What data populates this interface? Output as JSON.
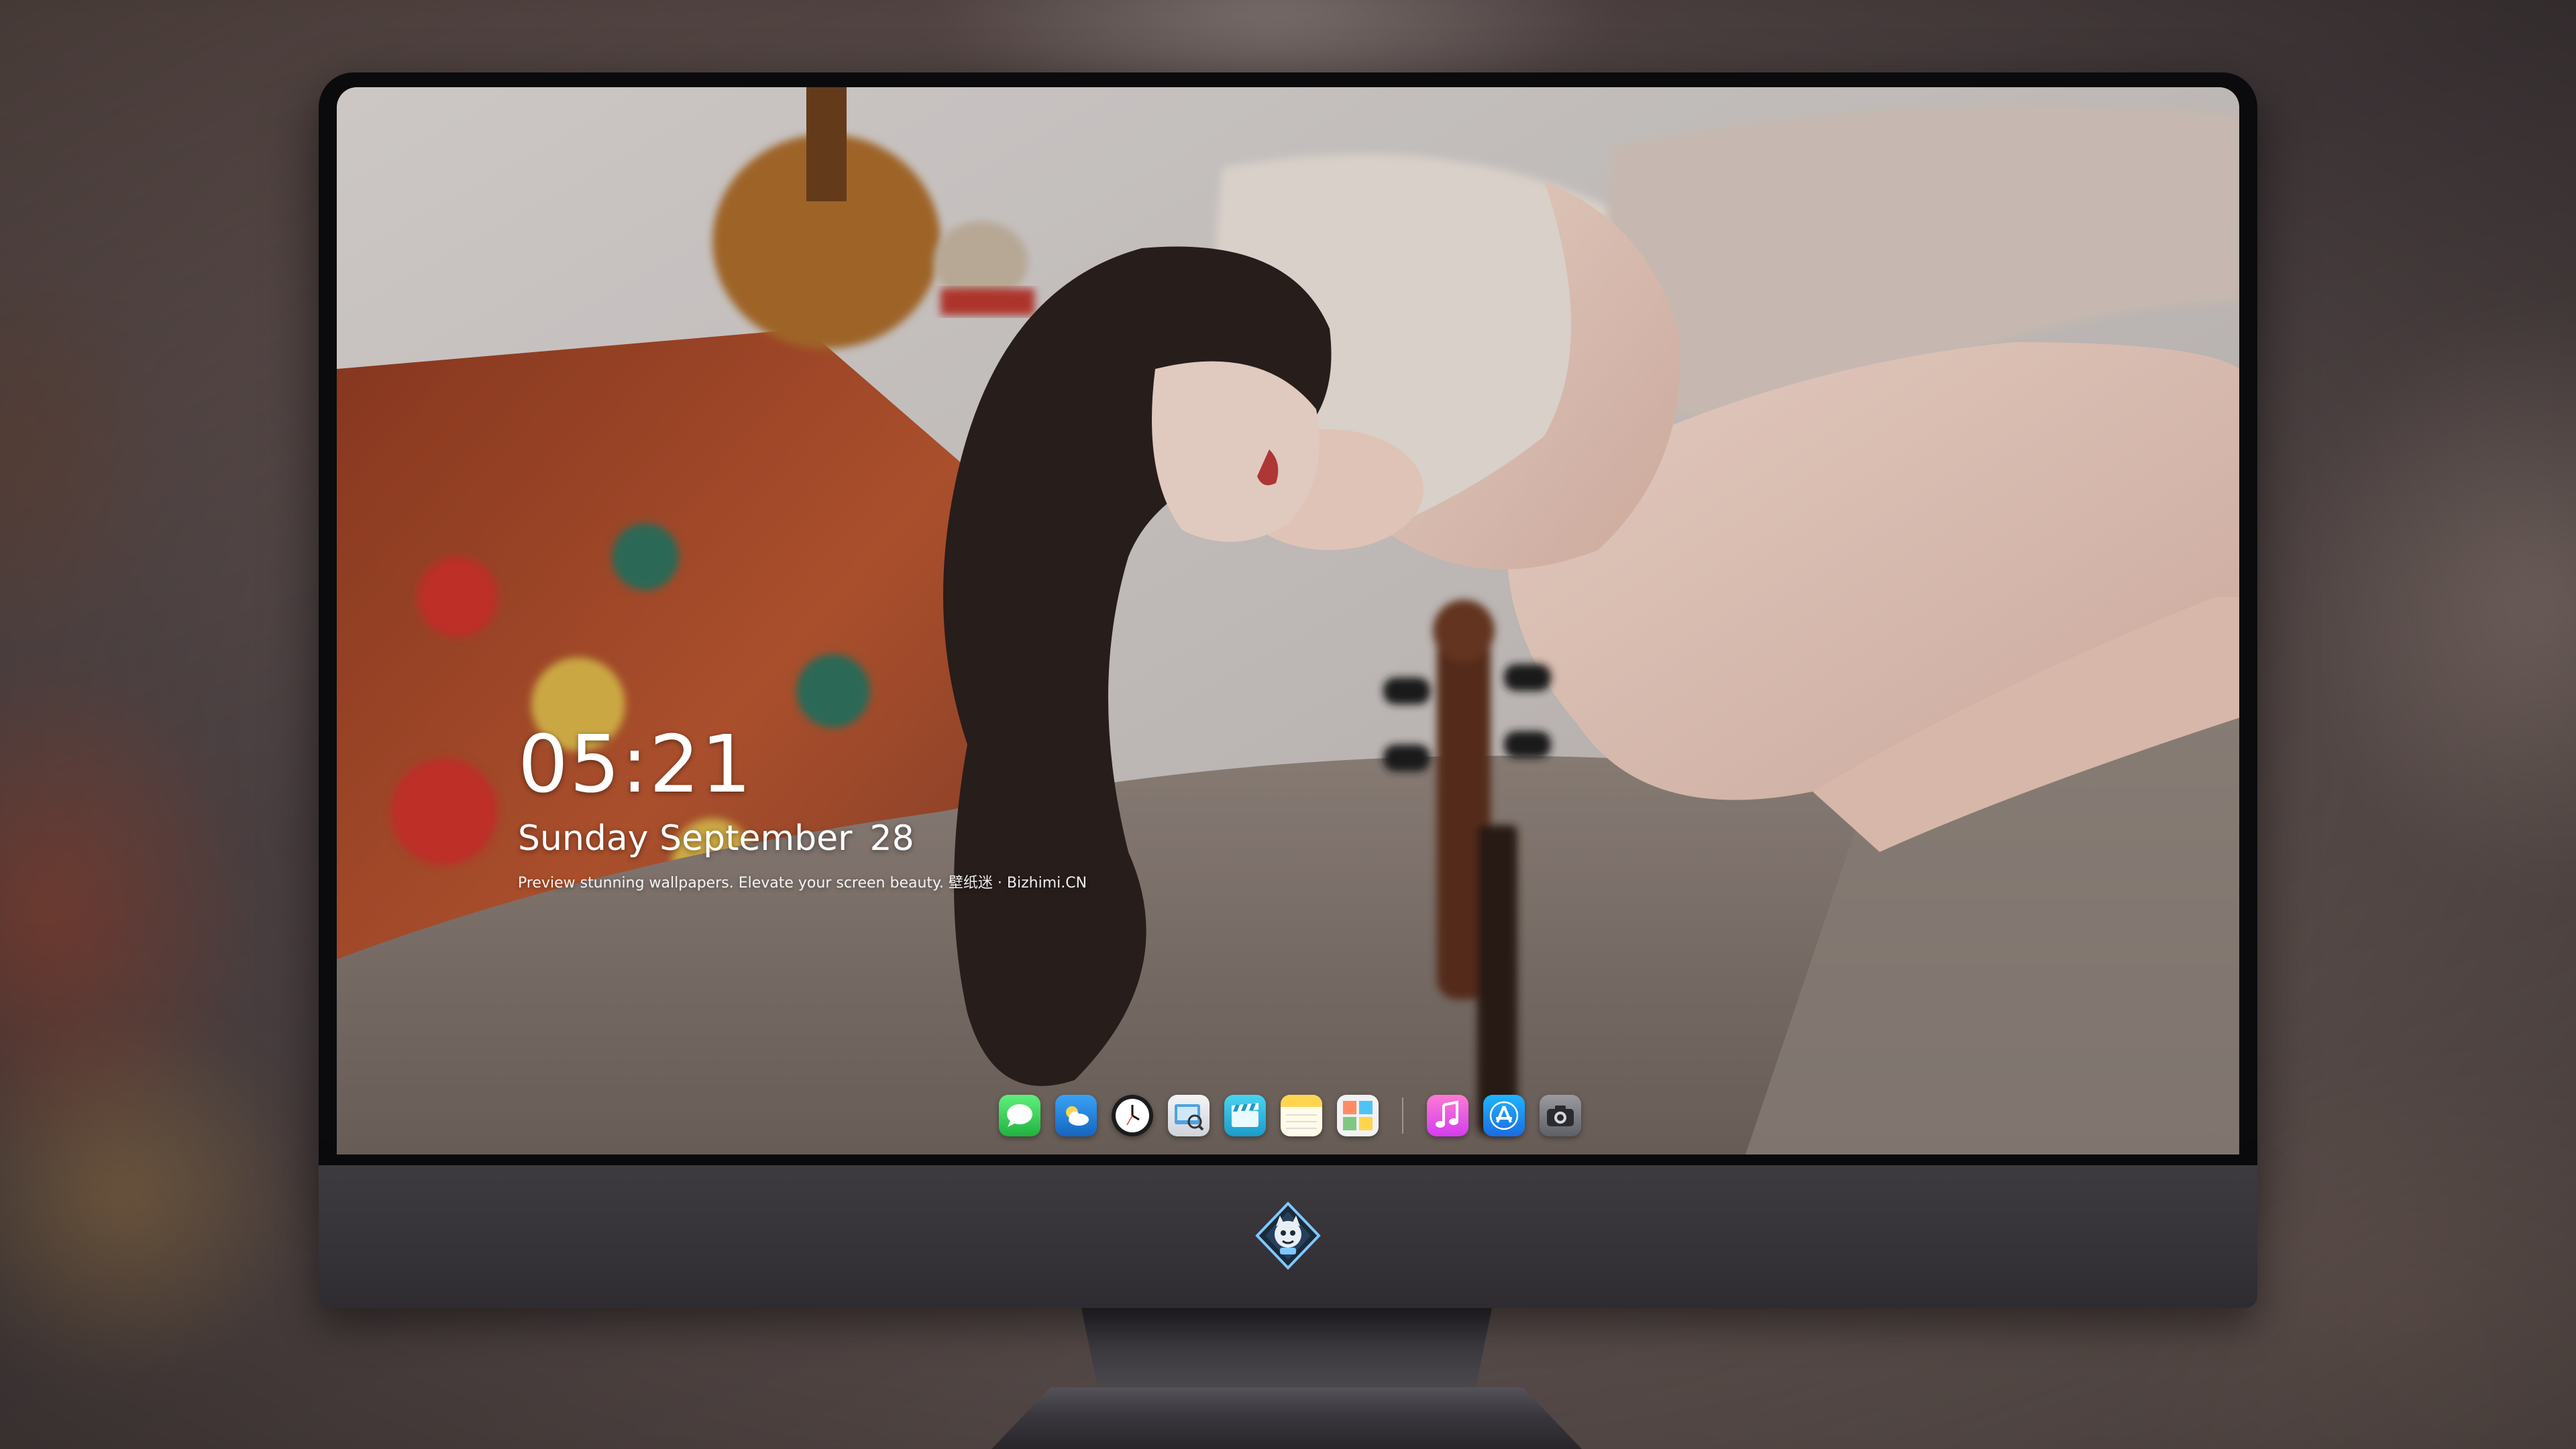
{
  "lockscreen": {
    "time": "05:21",
    "day_month": "Sunday September",
    "day_number": "28",
    "tagline": "Preview stunning wallpapers. Elevate your screen beauty. 壁纸迷 · Bizhimi.CN"
  },
  "dock": {
    "apps": [
      {
        "name": "messages-icon",
        "color": "#34c759"
      },
      {
        "name": "weather-icon",
        "color": "#1e88e5"
      },
      {
        "name": "clock-icon",
        "color": "#1c1c1e"
      },
      {
        "name": "preview-icon",
        "color": "#e8e8e8"
      },
      {
        "name": "clips-icon",
        "color": "#2bc0e4"
      },
      {
        "name": "notes-icon",
        "color": "#ffd54f"
      },
      {
        "name": "photo-booth-icon",
        "color": "#f5f5f5"
      },
      {
        "name": "music-icon",
        "color": "#fc3c8d"
      },
      {
        "name": "app-store-icon",
        "color": "#1e90ff"
      },
      {
        "name": "camera-icon",
        "color": "#8e8e93"
      }
    ]
  },
  "colors": {
    "bezel": "#0b0b0d",
    "chin": "#3d3a40",
    "text": "#ffffff"
  }
}
